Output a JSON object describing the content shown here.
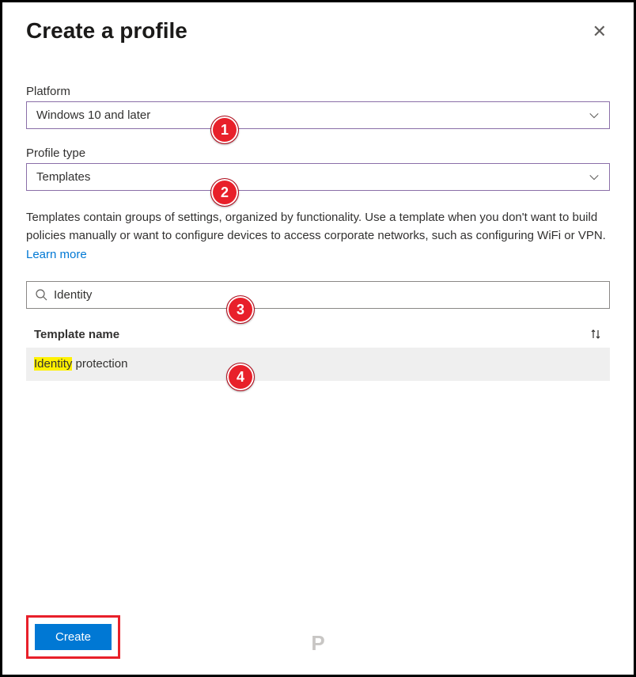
{
  "header": {
    "title": "Create a profile"
  },
  "platform": {
    "label": "Platform",
    "value": "Windows 10 and later"
  },
  "profileType": {
    "label": "Profile type",
    "value": "Templates"
  },
  "description": {
    "text": "Templates contain groups of settings, organized by functionality. Use a template when you don't want to build policies manually or want to configure devices to access corporate networks, such as configuring WiFi or VPN. ",
    "link": "Learn more"
  },
  "search": {
    "value": "Identity"
  },
  "table": {
    "header": "Template name",
    "rows": [
      {
        "highlight": "Identity",
        "rest": " protection"
      }
    ]
  },
  "footer": {
    "createLabel": "Create"
  },
  "logo": "P",
  "badges": [
    "1",
    "2",
    "3",
    "4"
  ]
}
